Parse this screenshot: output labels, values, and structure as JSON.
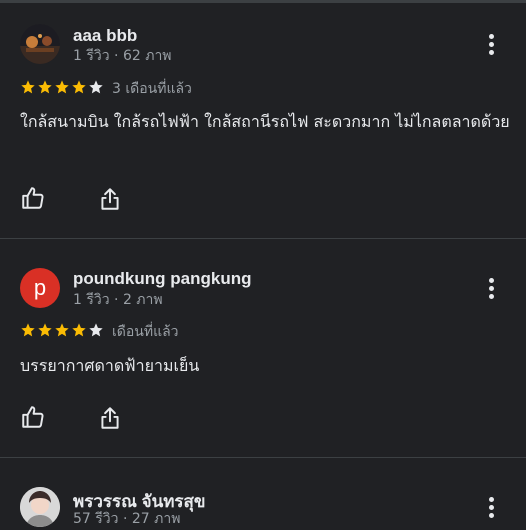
{
  "reviews": [
    {
      "name": "aaa bbb",
      "meta": "1 รีวิว · 62 ภาพ",
      "rating": 4,
      "when": "3 เดือนที่แล้ว",
      "text": "ใกล้สนามบิน ใกล้รถไฟฟ้า ใกล้สถานีรถไฟ สะดวกมาก ไม่ไกลตลาดด้วย",
      "avatar": {
        "type": "photo"
      }
    },
    {
      "name": "poundkung pangkung",
      "meta": "1 รีวิว · 2 ภาพ",
      "rating": 4,
      "when": "เดือนที่แล้ว",
      "text": "บรรยากาศดาดฟ้ายามเย็น",
      "avatar": {
        "type": "letter",
        "letter": "p",
        "color": "#d93025"
      }
    },
    {
      "name": "พรวรรณ จันทรสุข",
      "meta": "57 รีวิว · 27 ภาพ",
      "avatar": {
        "type": "photo"
      }
    }
  ],
  "colors": {
    "background": "#202124",
    "star_filled": "#fbbc04",
    "star_empty": "#e8eaed",
    "divider": "#3c4043"
  },
  "icons": [
    "more-vert-icon",
    "thumb-up-icon",
    "share-icon"
  ]
}
